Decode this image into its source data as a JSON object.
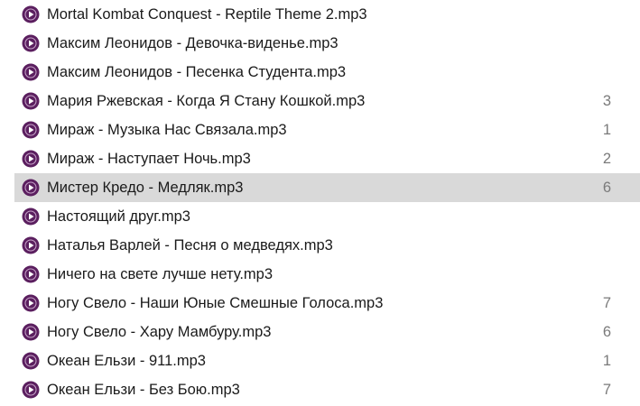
{
  "colors": {
    "icon_outer": "#5b1f5f",
    "icon_play": "#ffffff",
    "selected_row": "#d9d9d9",
    "count_text": "#7a7a7a"
  },
  "icon": "music-file-play-icon",
  "files": [
    {
      "name": "Mortal Kombat Conquest - Reptile Theme 2.mp3",
      "count": ""
    },
    {
      "name": "Максим Леонидов - Девочка-виденье.mp3",
      "count": ""
    },
    {
      "name": "Максим Леонидов - Песенка Студента.mp3",
      "count": ""
    },
    {
      "name": "Мария Ржевская - Когда Я Стану Кошкой.mp3",
      "count": "3"
    },
    {
      "name": "Мираж - Музыка Нас Связала.mp3",
      "count": "1"
    },
    {
      "name": "Мираж - Наступает Ночь.mp3",
      "count": "2"
    },
    {
      "name": "Мистер Кредо - Медляк.mp3",
      "count": "6"
    },
    {
      "name": "Настоящий друг.mp3",
      "count": ""
    },
    {
      "name": "Наталья Варлей - Песня о медведях.mp3",
      "count": ""
    },
    {
      "name": "Ничего на свете лучше нету.mp3",
      "count": ""
    },
    {
      "name": "Ногу Свело - Наши Юные Смешные Голоса.mp3",
      "count": "7"
    },
    {
      "name": "Ногу Свело - Хару Мамбуру.mp3",
      "count": "6"
    },
    {
      "name": "Океан Ельзи - 911.mp3",
      "count": "1"
    },
    {
      "name": "Океан Ельзи - Без Бою.mp3",
      "count": "7"
    }
  ],
  "selected_index": 6
}
